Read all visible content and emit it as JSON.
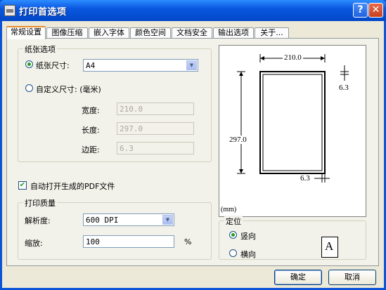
{
  "window": {
    "title": "打印首选项",
    "help_glyph": "?",
    "close_glyph": "✕"
  },
  "tabs": [
    "常规设置",
    "图像压缩",
    "嵌入字体",
    "颜色空间",
    "文档安全",
    "输出选项",
    "关于..."
  ],
  "paper": {
    "group_label": "纸张选项",
    "size_label": "纸张尺寸:",
    "size_value": "A4",
    "custom_label": "自定义尺寸: (毫米)",
    "width_label": "宽度:",
    "width_value": "210.0",
    "height_label": "长度:",
    "height_value": "297.0",
    "margin_label": "边距:",
    "margin_value": "6.3"
  },
  "auto_open_label": "自动打开生成的PDF文件",
  "quality": {
    "group_label": "打印质量",
    "resolution_label": "解析度:",
    "resolution_value": "600 DPI",
    "scale_label": "缩放:",
    "scale_value": "100",
    "scale_unit": "%"
  },
  "preview": {
    "width_dim": "210.0",
    "height_dim": "297.0",
    "margin_top_dim": "6.3",
    "margin_bottom_dim": "6.3",
    "unit": "(mm)"
  },
  "orientation": {
    "group_label": "定位",
    "portrait_label": "竖向",
    "landscape_label": "横向",
    "icon_letter": "A"
  },
  "buttons": {
    "ok": "确定",
    "cancel": "取消"
  },
  "icons": {
    "app": "printer-icon",
    "help": "help-icon",
    "close": "close-icon",
    "orientation": "portrait-page-icon"
  }
}
